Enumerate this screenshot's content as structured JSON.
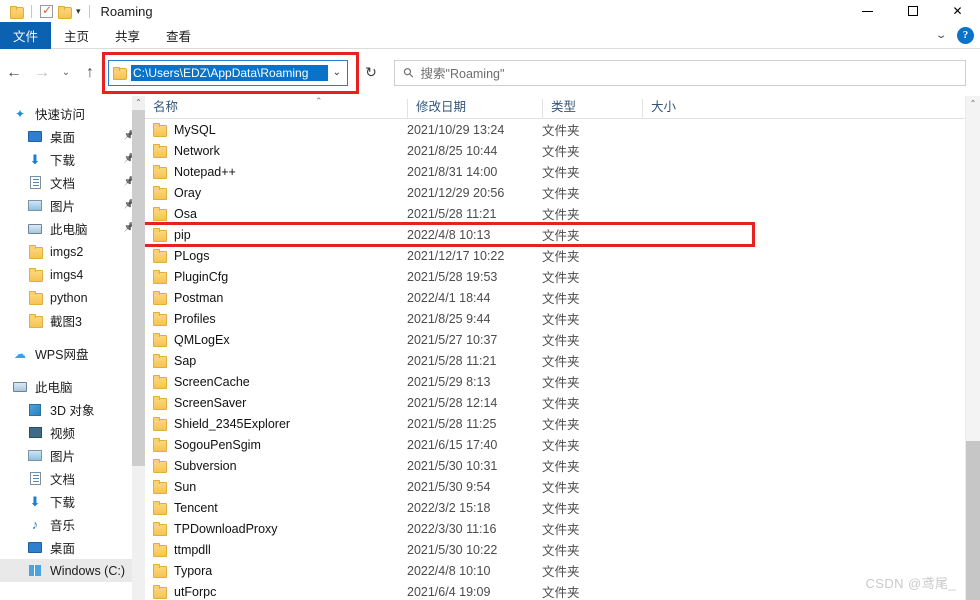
{
  "window": {
    "title": "Roaming",
    "quick_access_toolbar": [
      {
        "name": "folder-icon",
        "label": ""
      },
      {
        "name": "properties-icon",
        "label": ""
      },
      {
        "name": "new-folder-icon",
        "label": ""
      },
      {
        "name": "customize-caret-icon",
        "label": "▾"
      }
    ],
    "controls": {
      "minimize": "—",
      "maximize": "□",
      "close": "✕"
    }
  },
  "ribbon": {
    "tabs": [
      {
        "label": "文件",
        "active": true
      },
      {
        "label": "主页",
        "active": false
      },
      {
        "label": "共享",
        "active": false
      },
      {
        "label": "查看",
        "active": false
      }
    ],
    "collapse_caret": "⌄",
    "help_label": "?"
  },
  "nav": {
    "back": "←",
    "forward": "→",
    "recent_caret": "⌄",
    "up": "↑",
    "refresh": "↻"
  },
  "address": {
    "path": "C:\\Users\\EDZ\\AppData\\Roaming",
    "dropdown_caret": "⌄",
    "selected": true,
    "highlight_color": "#e8201f"
  },
  "search": {
    "placeholder": "搜索\"Roaming\"",
    "icon": "search-icon"
  },
  "sidebar": {
    "groups": [
      {
        "name": "quick-access",
        "label": "快速访问",
        "icon": "pin-star-icon",
        "items": [
          {
            "label": "桌面",
            "icon": "desktop-icon",
            "pinned": true
          },
          {
            "label": "下载",
            "icon": "download-icon",
            "pinned": true
          },
          {
            "label": "文档",
            "icon": "document-icon",
            "pinned": true
          },
          {
            "label": "图片",
            "icon": "picture-icon",
            "pinned": true
          },
          {
            "label": "此电脑",
            "icon": "this-pc-icon",
            "pinned": true
          },
          {
            "label": "imgs2",
            "icon": "folder-icon",
            "pinned": false
          },
          {
            "label": "imgs4",
            "icon": "folder-icon",
            "pinned": false
          },
          {
            "label": "python",
            "icon": "folder-icon",
            "pinned": false
          },
          {
            "label": "截图3",
            "icon": "folder-icon",
            "pinned": false
          }
        ]
      },
      {
        "name": "wps-cloud",
        "label": "WPS网盘",
        "icon": "cloud-icon",
        "items": []
      },
      {
        "name": "this-pc",
        "label": "此电脑",
        "icon": "this-pc-icon",
        "items": [
          {
            "label": "3D 对象",
            "icon": "3d-objects-icon",
            "pinned": false
          },
          {
            "label": "视频",
            "icon": "video-icon",
            "pinned": false
          },
          {
            "label": "图片",
            "icon": "picture-icon",
            "pinned": false
          },
          {
            "label": "文档",
            "icon": "document-icon",
            "pinned": false
          },
          {
            "label": "下载",
            "icon": "download-icon",
            "pinned": false
          },
          {
            "label": "音乐",
            "icon": "music-icon",
            "pinned": false
          },
          {
            "label": "桌面",
            "icon": "desktop-icon",
            "pinned": false
          },
          {
            "label": "Windows (C:)",
            "icon": "windows-drive-icon",
            "pinned": false,
            "highlighted": true
          }
        ]
      }
    ]
  },
  "filelist": {
    "columns": [
      {
        "key": "name",
        "label": "名称"
      },
      {
        "key": "date",
        "label": "修改日期"
      },
      {
        "key": "type",
        "label": "类型"
      },
      {
        "key": "size",
        "label": "大小"
      }
    ],
    "sort_indicator": "⌃",
    "highlighted_row": "pip",
    "highlight_color": "#e8201f",
    "rows": [
      {
        "name": "MySQL",
        "date": "2021/10/29 13:24",
        "type": "文件夹",
        "size": ""
      },
      {
        "name": "Network",
        "date": "2021/8/25 10:44",
        "type": "文件夹",
        "size": ""
      },
      {
        "name": "Notepad++",
        "date": "2021/8/31 14:00",
        "type": "文件夹",
        "size": ""
      },
      {
        "name": "Oray",
        "date": "2021/12/29 20:56",
        "type": "文件夹",
        "size": ""
      },
      {
        "name": "Osa",
        "date": "2021/5/28 11:21",
        "type": "文件夹",
        "size": ""
      },
      {
        "name": "pip",
        "date": "2022/4/8 10:13",
        "type": "文件夹",
        "size": ""
      },
      {
        "name": "PLogs",
        "date": "2021/12/17 10:22",
        "type": "文件夹",
        "size": ""
      },
      {
        "name": "PluginCfg",
        "date": "2021/5/28 19:53",
        "type": "文件夹",
        "size": ""
      },
      {
        "name": "Postman",
        "date": "2022/4/1 18:44",
        "type": "文件夹",
        "size": ""
      },
      {
        "name": "Profiles",
        "date": "2021/8/25 9:44",
        "type": "文件夹",
        "size": ""
      },
      {
        "name": "QMLogEx",
        "date": "2021/5/27 10:37",
        "type": "文件夹",
        "size": ""
      },
      {
        "name": "Sap",
        "date": "2021/5/28 11:21",
        "type": "文件夹",
        "size": ""
      },
      {
        "name": "ScreenCache",
        "date": "2021/5/29 8:13",
        "type": "文件夹",
        "size": ""
      },
      {
        "name": "ScreenSaver",
        "date": "2021/5/28 12:14",
        "type": "文件夹",
        "size": ""
      },
      {
        "name": "Shield_2345Explorer",
        "date": "2021/5/28 11:25",
        "type": "文件夹",
        "size": ""
      },
      {
        "name": "SogouPenSgim",
        "date": "2021/6/15 17:40",
        "type": "文件夹",
        "size": ""
      },
      {
        "name": "Subversion",
        "date": "2021/5/30 10:31",
        "type": "文件夹",
        "size": ""
      },
      {
        "name": "Sun",
        "date": "2021/5/30 9:54",
        "type": "文件夹",
        "size": ""
      },
      {
        "name": "Tencent",
        "date": "2022/3/2 15:18",
        "type": "文件夹",
        "size": ""
      },
      {
        "name": "TPDownloadProxy",
        "date": "2022/3/30 11:16",
        "type": "文件夹",
        "size": ""
      },
      {
        "name": "ttmpdll",
        "date": "2021/5/30 10:22",
        "type": "文件夹",
        "size": ""
      },
      {
        "name": "Typora",
        "date": "2022/4/8 10:10",
        "type": "文件夹",
        "size": ""
      },
      {
        "name": "utForpc",
        "date": "2021/6/4 19:09",
        "type": "文件夹",
        "size": ""
      }
    ]
  },
  "scrollbars": {
    "sidebar_up_arrow": "⌃",
    "list_up_arrow": "⌃"
  },
  "watermark": "CSDN @鸢尾_"
}
